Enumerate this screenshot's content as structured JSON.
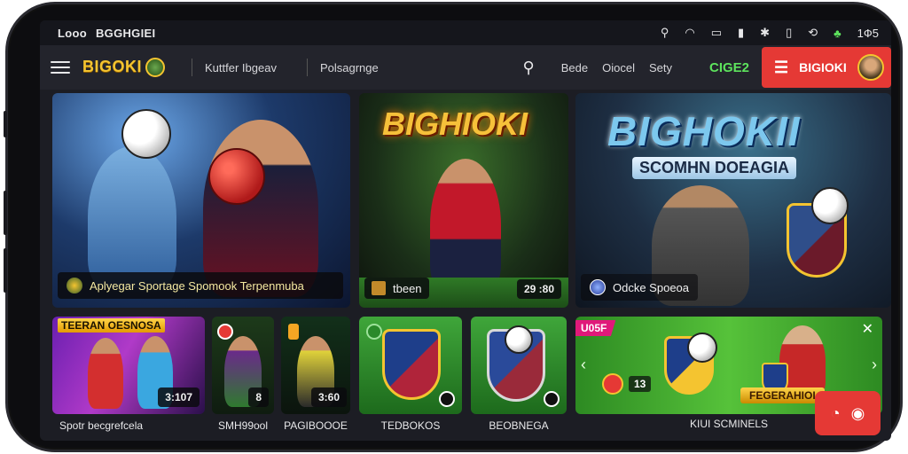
{
  "status_bar": {
    "left_1": "Looo",
    "left_2": "BGGHGIEI",
    "time": "1Ф5"
  },
  "topbar": {
    "logo": "BIGOKI",
    "nav_1": "Kuttfer Ibgeav",
    "nav_2": "Polsagrnge",
    "right_1": "Bede",
    "right_2": "Oiocel",
    "right_3": "Sety",
    "promo": "CIGE2",
    "cta_label": "BIGIOKI"
  },
  "hero": {
    "tile1_caption": "Aplyegar Sportage Spomook Terpenmuba",
    "tile2_title": "BIGHIOKI",
    "tile2_caption": "tbeen",
    "tile2_chip": "29 :80",
    "tile3_title": "BIGHOKII",
    "tile3_subtitle": "SCOMHN DOEAGIA",
    "tile3_caption": "Odcke Spoeoa"
  },
  "row2": {
    "card1_banner": "TEERAN OESNOSA",
    "card1_chip": "3:107",
    "card1_label": "Spotr becgrefcela",
    "card2_chip": "8",
    "card2_label": "SMH99ool",
    "card3_chip": "3:60",
    "card3_label": "PAGIBOOOE",
    "card4_label": "TEDBOKOS",
    "card5_label": "BEOBNEGA",
    "card6_badge": "U05F",
    "card6_chip": "13",
    "card6_ribbon": "FEGERAHIOI",
    "card6_label": "KIUI SCMINELS"
  },
  "colors": {
    "accent_red": "#e53935",
    "gold": "#f4c430",
    "green": "#5de35d"
  }
}
